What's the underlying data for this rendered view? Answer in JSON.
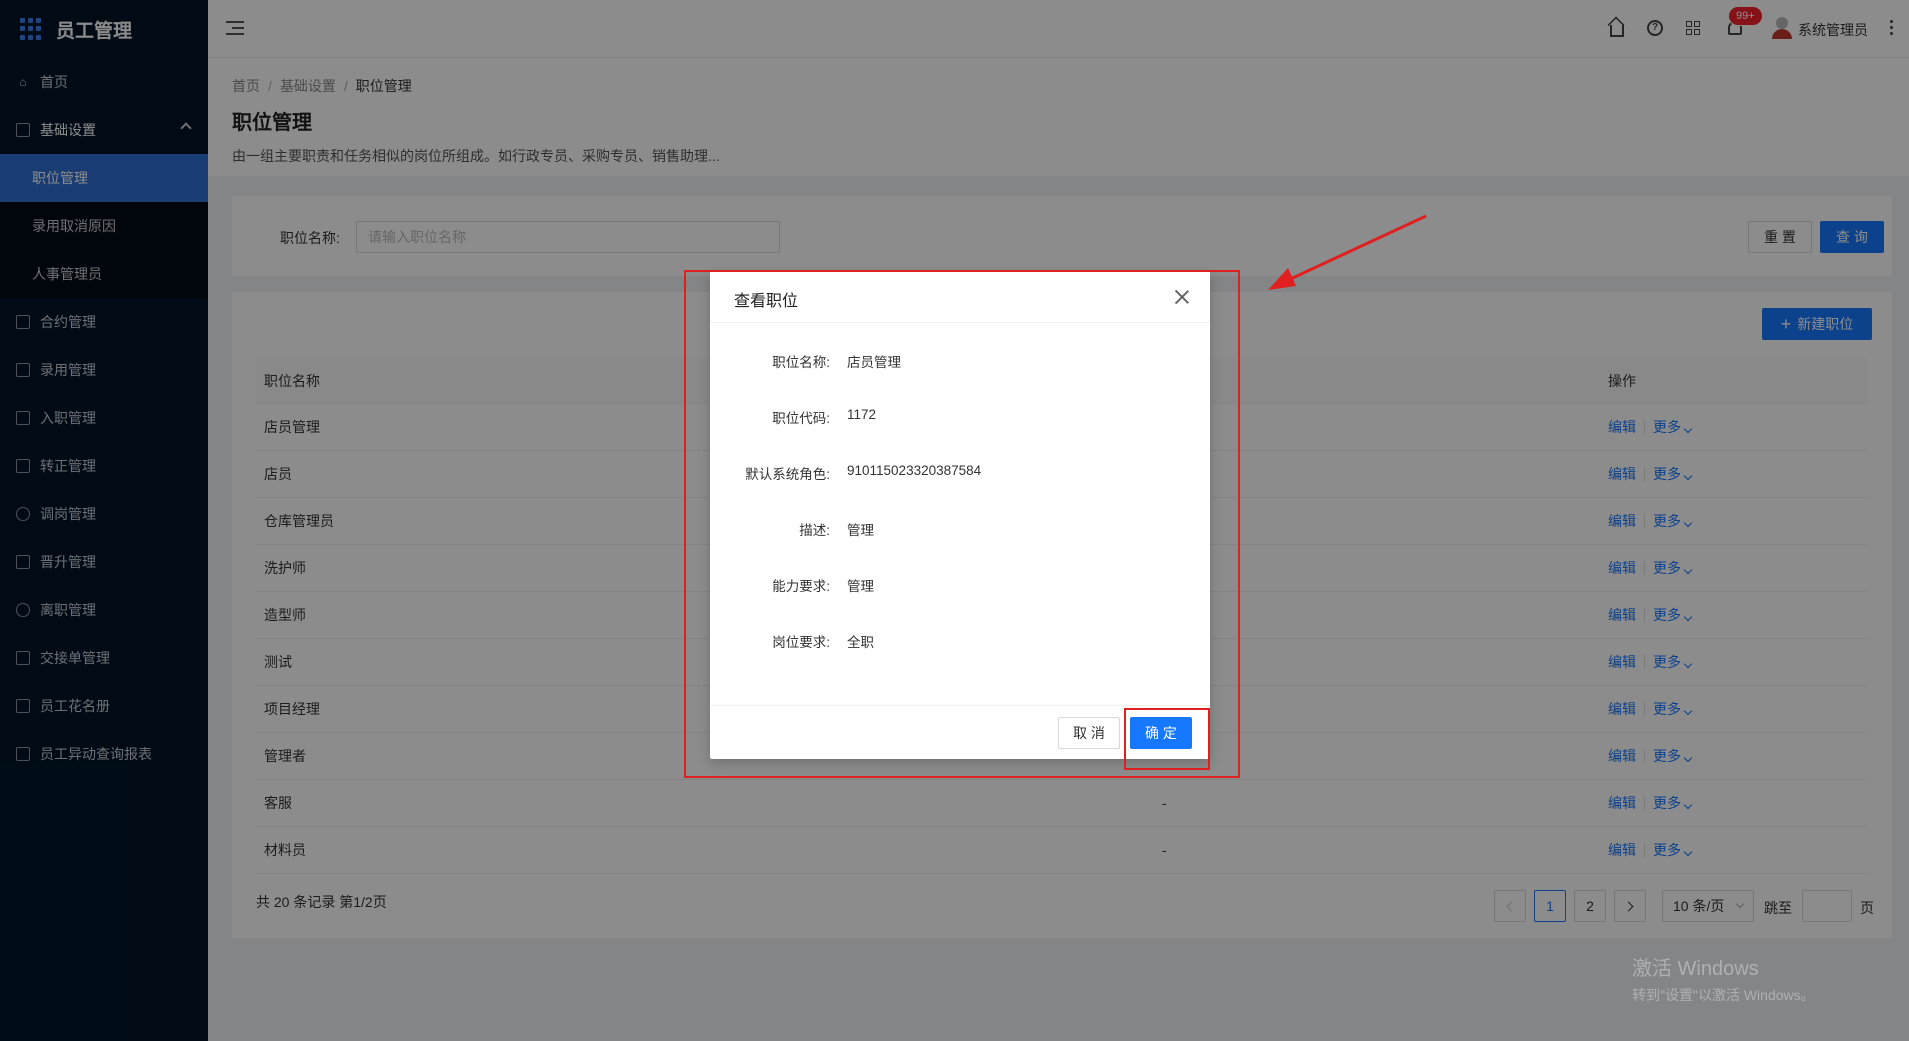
{
  "app": {
    "title": "员工管理"
  },
  "sidebar": {
    "items": [
      {
        "label": "首页",
        "icon": "home-icon"
      },
      {
        "label": "基础设置",
        "icon": "mail-icon",
        "open": true,
        "children": [
          {
            "label": "职位管理",
            "active": true
          },
          {
            "label": "录用取消原因"
          },
          {
            "label": "人事管理员"
          }
        ]
      },
      {
        "label": "合约管理",
        "icon": "calendar-icon"
      },
      {
        "label": "录用管理",
        "icon": "book-icon"
      },
      {
        "label": "入职管理",
        "icon": "bookmark-icon"
      },
      {
        "label": "转正管理",
        "icon": "apps-icon"
      },
      {
        "label": "调岗管理",
        "icon": "user-icon"
      },
      {
        "label": "晋升管理",
        "icon": "doc-icon"
      },
      {
        "label": "离职管理",
        "icon": "leave-icon"
      },
      {
        "label": "交接单管理",
        "icon": "copy-icon"
      },
      {
        "label": "员工花名册",
        "icon": "roster-icon"
      },
      {
        "label": "员工异动查询报表",
        "icon": "report-icon"
      }
    ]
  },
  "header": {
    "badge": "99+",
    "username": "系统管理员"
  },
  "page": {
    "breadcrumb": [
      "首页",
      "基础设置",
      "职位管理"
    ],
    "title": "职位管理",
    "description": "由一组主要职责和任务相似的岗位所组成。如行政专员、采购专员、销售助理..."
  },
  "search": {
    "label": "职位名称:",
    "placeholder": "请输入职位名称",
    "value": "",
    "reset_label": "重 置",
    "query_label": "查 询"
  },
  "table": {
    "new_label": "新建职位",
    "columns": {
      "name": "职位名称",
      "action": "操作"
    },
    "rows": [
      {
        "name": "店员管理",
        "mid": ""
      },
      {
        "name": "店员",
        "mid": ""
      },
      {
        "name": "仓库管理员",
        "mid": ""
      },
      {
        "name": "洗护师",
        "mid": ""
      },
      {
        "name": "造型师",
        "mid": ""
      },
      {
        "name": "测试",
        "mid": ""
      },
      {
        "name": "项目经理",
        "mid": ""
      },
      {
        "name": "管理者",
        "mid": ""
      },
      {
        "name": "客服",
        "mid": "-"
      },
      {
        "name": "材料员",
        "mid": "-"
      }
    ],
    "edit_label": "编辑",
    "more_label": "更多",
    "footer": "共 20 条记录 第1/2页"
  },
  "pagination": {
    "pages": [
      "1",
      "2"
    ],
    "current": "1",
    "page_size": "10 条/页",
    "jump_label": "跳至",
    "page_unit": "页"
  },
  "modal": {
    "title": "查看职位",
    "fields": [
      {
        "label": "职位名称:",
        "value": "店员管理"
      },
      {
        "label": "职位代码:",
        "value": "1172"
      },
      {
        "label": "默认系统角色:",
        "value": "910115023320387584"
      },
      {
        "label": "描述:",
        "value": "管理"
      },
      {
        "label": "能力要求:",
        "value": "管理"
      },
      {
        "label": "岗位要求:",
        "value": "全职"
      }
    ],
    "cancel_label": "取 消",
    "ok_label": "确 定"
  },
  "watermark": {
    "line1": "激活 Windows",
    "line2": "转到\"设置\"以激活 Windows。"
  },
  "colors": {
    "primary": "#1677ff",
    "sidebar_bg": "#001529",
    "annotation": "#e02020"
  }
}
